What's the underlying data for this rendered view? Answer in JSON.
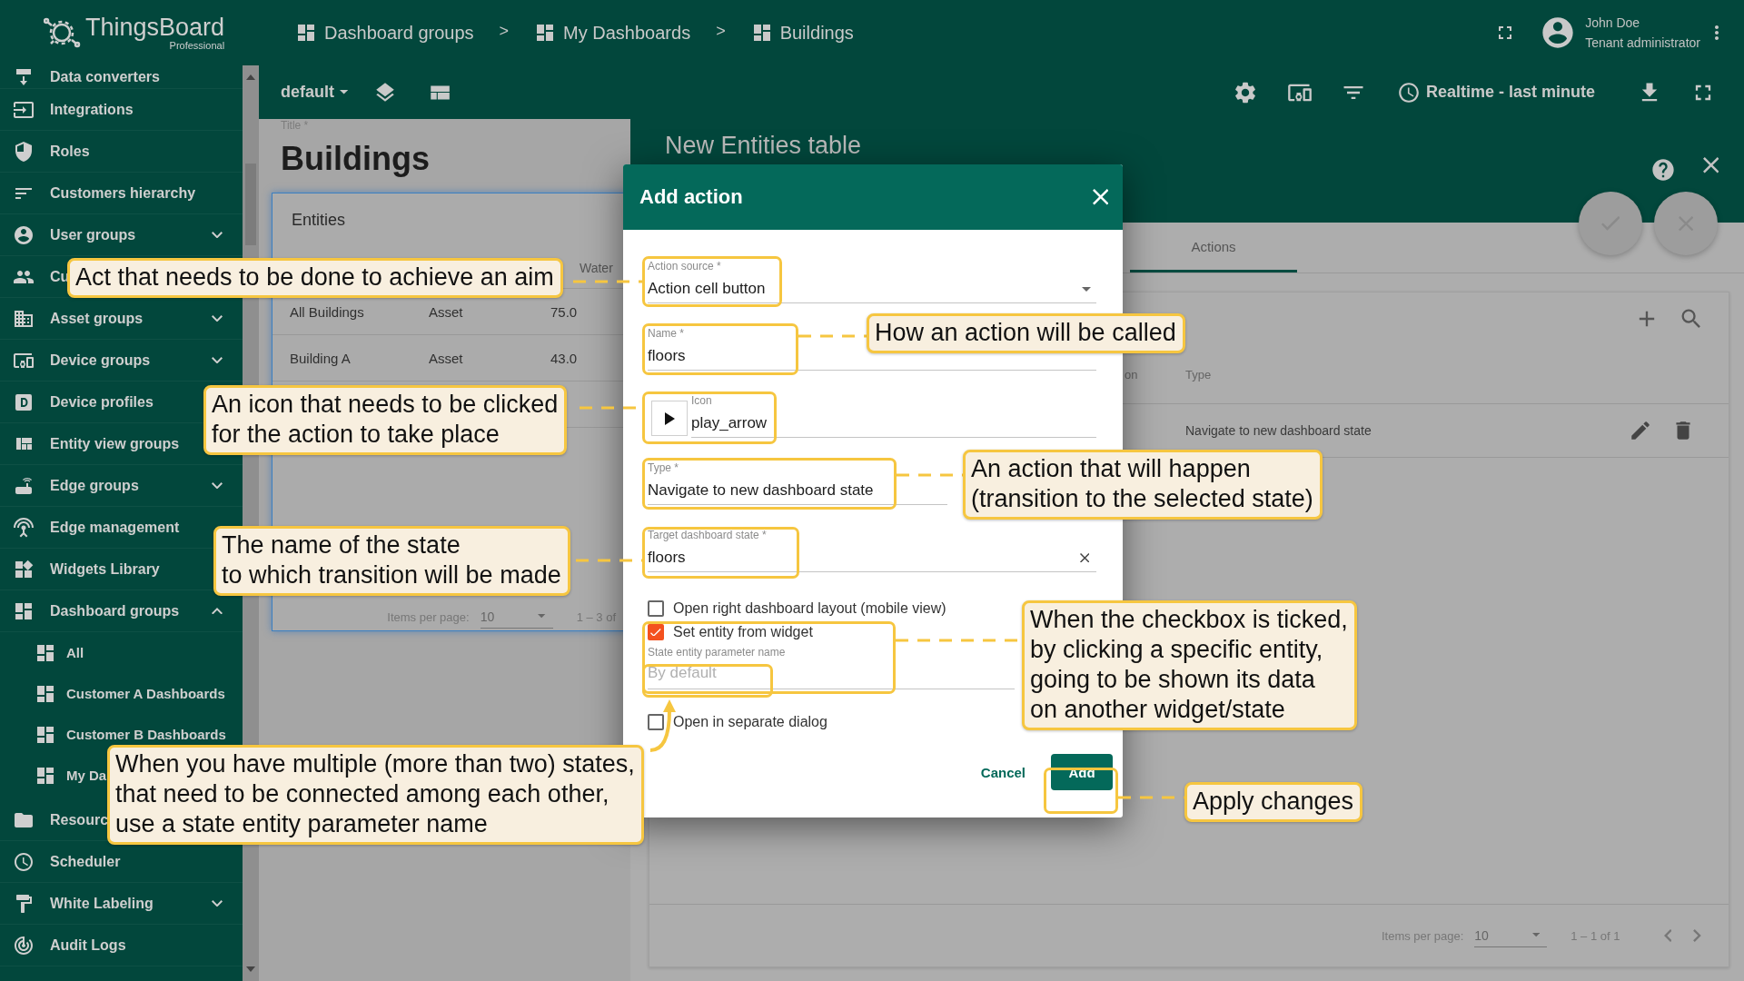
{
  "header": {
    "logo": {
      "name": "ThingsBoard",
      "edition": "Professional"
    },
    "breadcrumbs": [
      {
        "kind": "crumb",
        "label": "Dashboard groups"
      },
      {
        "kind": "separator",
        "label": ">"
      },
      {
        "kind": "crumb",
        "label": "My Dashboards"
      },
      {
        "kind": "separator",
        "label": ">"
      },
      {
        "kind": "crumb",
        "label": "Buildings"
      }
    ],
    "user": {
      "name": "John Doe",
      "role": "Tenant administrator"
    }
  },
  "sidebar": {
    "items": [
      {
        "kind": "link",
        "label": "Data converters"
      },
      {
        "kind": "link",
        "label": "Integrations"
      },
      {
        "kind": "link",
        "label": "Roles"
      },
      {
        "kind": "link",
        "label": "Customers hierarchy"
      },
      {
        "kind": "group",
        "label": "User groups",
        "expanded": false
      },
      {
        "kind": "link",
        "label": "Cu"
      },
      {
        "kind": "group",
        "label": "Asset groups",
        "expanded": false
      },
      {
        "kind": "group",
        "label": "Device groups",
        "expanded": false
      },
      {
        "kind": "link",
        "label": "Device profiles"
      },
      {
        "kind": "link",
        "label": "Entity view groups"
      },
      {
        "kind": "group",
        "label": "Edge groups",
        "expanded": false
      },
      {
        "kind": "link",
        "label": "Edge management"
      },
      {
        "kind": "link",
        "label": "Widgets Library"
      },
      {
        "kind": "group",
        "label": "Dashboard groups",
        "expanded": true,
        "children": [
          {
            "label": "All"
          },
          {
            "label": "Customer A Dashboards"
          },
          {
            "label": "Customer B Dashboards"
          },
          {
            "label": "My Da"
          }
        ]
      },
      {
        "kind": "link",
        "label": "Resourc"
      },
      {
        "kind": "link",
        "label": "Scheduler"
      },
      {
        "kind": "group",
        "label": "White Labeling",
        "expanded": false
      },
      {
        "kind": "link",
        "label": "Audit Logs"
      }
    ]
  },
  "toolbar": {
    "state": "default",
    "timewindow": "Realtime - last minute"
  },
  "dashboard": {
    "title_label": "Title *",
    "title": "Buildings",
    "widget": {
      "title": "Entities",
      "column_3": "Water",
      "rows": [
        [
          "All Buildings",
          "Asset",
          "75.0"
        ],
        [
          "Building A",
          "Asset",
          "43.0"
        ]
      ],
      "pagination": {
        "label": "Items per page:",
        "page_size": "10",
        "range": "1 – 3 of"
      }
    }
  },
  "panel": {
    "title": "New Entities table",
    "tabs": [
      {
        "label": "Actions",
        "selected": true
      }
    ],
    "table": {
      "column_1": "on",
      "column_2": "Type",
      "rows": [
        {
          "type": "Navigate to new dashboard state"
        }
      ]
    },
    "pagination": {
      "label": "Items per page:",
      "page_size": "10",
      "range": "1 – 1 of 1"
    }
  },
  "dialog": {
    "title": "Add action",
    "fields": [
      {
        "kind": "select",
        "label": "Action source *",
        "value": "Action cell button"
      },
      {
        "kind": "text",
        "label": "Name *",
        "value": "floors"
      },
      {
        "kind": "icon",
        "label": "Icon",
        "value": "play_arrow"
      },
      {
        "kind": "text",
        "label": "Type *",
        "value": "Navigate to new dashboard state"
      },
      {
        "kind": "clearable",
        "label": "Target dashboard state *",
        "value": "floors"
      }
    ],
    "checkboxes": [
      {
        "label": "Open right dashboard layout (mobile view)",
        "checked": false
      },
      {
        "label": "Set entity from widget",
        "checked": true,
        "field": {
          "label": "State entity parameter name",
          "placeholder": "By default"
        }
      },
      {
        "label": "Open in separate dialog",
        "checked": false
      }
    ],
    "buttons": [
      {
        "kind": "text",
        "label": "Cancel"
      },
      {
        "kind": "primary",
        "label": "Add"
      }
    ]
  },
  "callouts": [
    {
      "lines": [
        "Act that needs to be done to achieve an aim"
      ]
    },
    {
      "lines": [
        "How an action will be called"
      ]
    },
    {
      "lines": [
        "An icon that needs to be clicked",
        "for the action to take place"
      ]
    },
    {
      "lines": [
        "An action that will happen",
        "(transition to the selected state)"
      ]
    },
    {
      "lines": [
        "The name of the state",
        "to which transition will be made"
      ]
    },
    {
      "lines": [
        "When the checkbox is ticked,",
        "by clicking a specific entity,",
        "going to be shown its data",
        "on another widget/state"
      ]
    },
    {
      "lines": [
        "When you have multiple (more than two) states,",
        "that need to be connected among each other,",
        "use a state entity parameter name"
      ]
    },
    {
      "lines": [
        "Apply changes"
      ]
    }
  ]
}
